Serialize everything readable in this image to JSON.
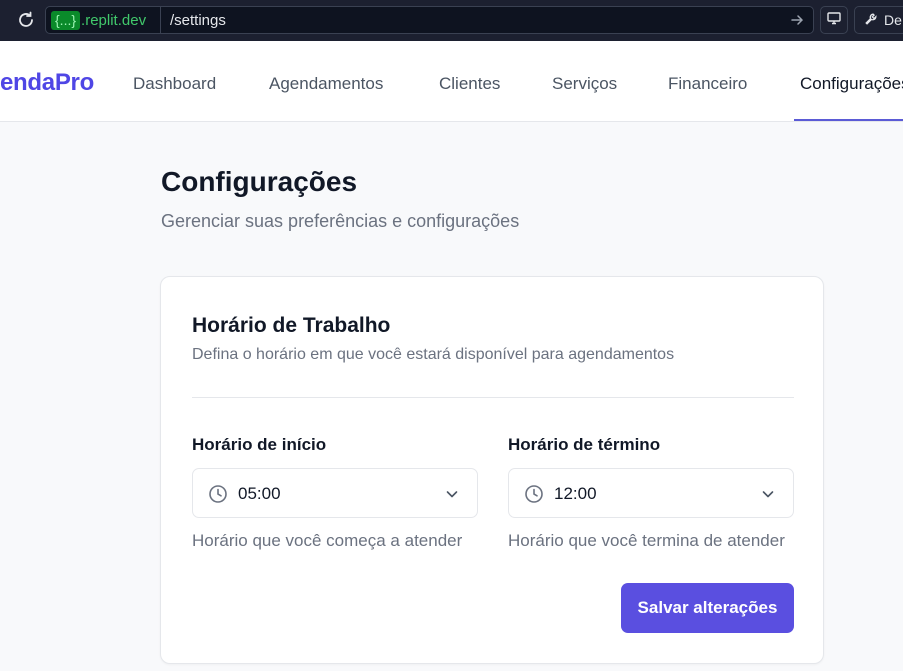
{
  "browser": {
    "url_badge": "{...}",
    "url_domain": ".replit.dev",
    "url_path": "/settings",
    "dev_label": "De"
  },
  "nav": {
    "brand": "endaPro",
    "items": [
      {
        "label": "Dashboard",
        "active": false
      },
      {
        "label": "Agendamentos",
        "active": false
      },
      {
        "label": "Clientes",
        "active": false
      },
      {
        "label": "Serviços",
        "active": false
      },
      {
        "label": "Financeiro",
        "active": false
      },
      {
        "label": "Configurações",
        "active": true
      }
    ]
  },
  "page": {
    "title": "Configurações",
    "subtitle": "Gerenciar suas preferências e configurações"
  },
  "card": {
    "title": "Horário de Trabalho",
    "description": "Defina o horário em que você estará disponível para agendamentos",
    "start": {
      "label": "Horário de início",
      "value": "05:00",
      "hint": "Horário que você começa a atender"
    },
    "end": {
      "label": "Horário de término",
      "value": "12:00",
      "hint": "Horário que você termina de atender"
    },
    "save_label": "Salvar alterações"
  },
  "colors": {
    "accent": "#5a4fe0",
    "brand": "#4f46e5",
    "browser_bg": "#1c2030"
  },
  "icons": [
    "reload-icon",
    "arrow-right-icon",
    "monitor-icon",
    "wrench-icon",
    "clock-icon",
    "chevron-down-icon"
  ]
}
